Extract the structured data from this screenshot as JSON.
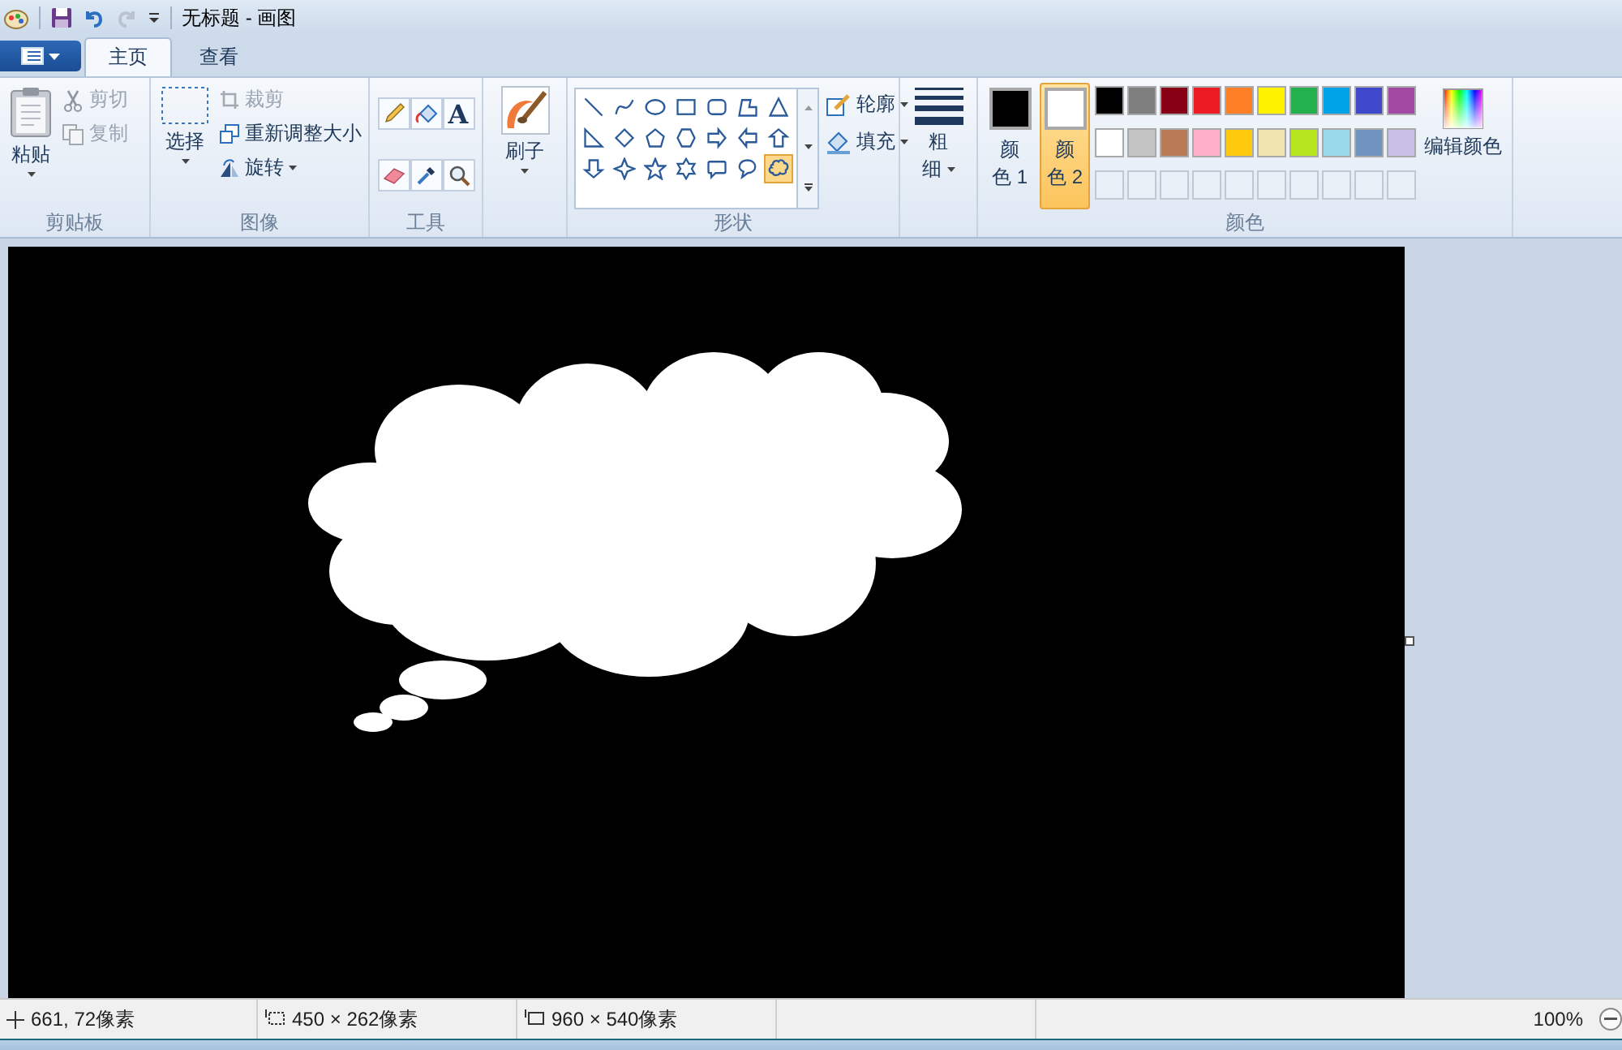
{
  "window": {
    "title": "无标题 - 画图"
  },
  "tabs": [
    {
      "label": "主页",
      "selected": true
    },
    {
      "label": "查看",
      "selected": false
    }
  ],
  "clipboard": {
    "paste": "粘贴",
    "cut": {
      "label": "剪切",
      "disabled": true
    },
    "copy": {
      "label": "复制",
      "disabled": true
    },
    "group_label": "剪贴板"
  },
  "image": {
    "select": "选择",
    "crop": {
      "label": "裁剪",
      "disabled": true
    },
    "resize": {
      "label": "重新调整大小",
      "disabled": false
    },
    "rotate": "旋转",
    "group_label": "图像"
  },
  "tools": {
    "items": [
      {
        "kind": "pencil"
      },
      {
        "kind": "fill"
      },
      {
        "kind": "text",
        "glyph": "A"
      },
      {
        "kind": "eraser"
      },
      {
        "kind": "picker"
      },
      {
        "kind": "magnifier"
      }
    ],
    "group_label": "工具"
  },
  "brushes": {
    "label": "刷子"
  },
  "shapes": {
    "items": [
      {
        "kind": "line",
        "selected": false
      },
      {
        "kind": "curve",
        "selected": false
      },
      {
        "kind": "oval",
        "selected": false
      },
      {
        "kind": "rect",
        "selected": false
      },
      {
        "kind": "roundrect",
        "selected": false
      },
      {
        "kind": "polygon",
        "selected": false
      },
      {
        "kind": "triangle",
        "selected": false
      },
      {
        "kind": "rtriangle",
        "selected": false
      },
      {
        "kind": "diamond",
        "selected": false
      },
      {
        "kind": "pentagon",
        "selected": false
      },
      {
        "kind": "hexagon",
        "selected": false
      },
      {
        "kind": "arrow-right",
        "selected": false
      },
      {
        "kind": "arrow-left",
        "selected": false
      },
      {
        "kind": "arrow-up",
        "selected": false
      },
      {
        "kind": "arrow-down",
        "selected": false
      },
      {
        "kind": "star4",
        "selected": false
      },
      {
        "kind": "star5",
        "selected": false
      },
      {
        "kind": "star6",
        "selected": false
      },
      {
        "kind": "callout-rect",
        "selected": false
      },
      {
        "kind": "callout-oval",
        "selected": false
      },
      {
        "kind": "callout-cloud",
        "selected": true
      }
    ],
    "outline": "轮廓",
    "fill": "填充",
    "group_label": "形状"
  },
  "size": {
    "label_lines": [
      "粗",
      "细"
    ]
  },
  "colors": {
    "color1": {
      "label_lines": [
        "颜",
        "色 1"
      ],
      "color": "#000000",
      "selected": false
    },
    "color2": {
      "label_lines": [
        "颜",
        "色 2"
      ],
      "color": "#ffffff",
      "selected": true
    },
    "palette": [
      {
        "color": "#000000"
      },
      {
        "color": "#7f7f7f"
      },
      {
        "color": "#880015"
      },
      {
        "color": "#ed1c24"
      },
      {
        "color": "#ff7f27"
      },
      {
        "color": "#fff200"
      },
      {
        "color": "#22b14c"
      },
      {
        "color": "#00a2e8"
      },
      {
        "color": "#3f48cc"
      },
      {
        "color": "#a349a4"
      },
      {
        "color": "#ffffff"
      },
      {
        "color": "#c3c3c3"
      },
      {
        "color": "#b97a57"
      },
      {
        "color": "#ffaec9"
      },
      {
        "color": "#ffc90e"
      },
      {
        "color": "#efe4b0"
      },
      {
        "color": "#b5e61d"
      },
      {
        "color": "#99d9ea"
      },
      {
        "color": "#7092be"
      },
      {
        "color": "#c8bfe7"
      }
    ],
    "edit": "编辑颜色",
    "group_label": "颜色"
  },
  "status_bar": {
    "cursor": "661, 72像素",
    "selection": "450 × 262像素",
    "canvas_size": "960 × 540像素",
    "zoom": "100%"
  }
}
